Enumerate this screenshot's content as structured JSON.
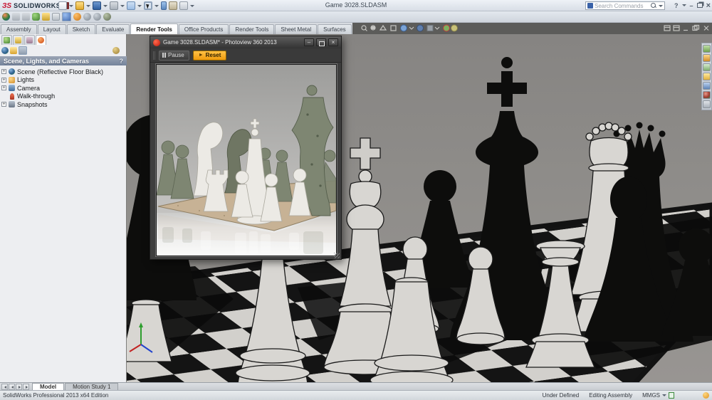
{
  "titlebar": {
    "brand_mark": "ЗS",
    "brand": "SOLIDWORKS",
    "title": "Game 3028.SLDASM",
    "search_placeholder": "Search Commands",
    "help_glyph": "?",
    "minimize_glyph": "–",
    "close_glyph": "×"
  },
  "standard_toolbar_icons": [
    "new",
    "open",
    "save",
    "print",
    "undo",
    "select",
    "hide-show",
    "appearance",
    "view-settings"
  ],
  "render_toolbar_icons": [
    "edit-appearance",
    "copy-appearance",
    "paste-appearance",
    "edit-scene",
    "edit-decal",
    "target-area",
    "preview-window",
    "integrated-preview",
    "final-render",
    "render-region",
    "options"
  ],
  "commandbar": {
    "tabs": [
      {
        "label": "Assembly",
        "active": false
      },
      {
        "label": "Layout",
        "active": false
      },
      {
        "label": "Sketch",
        "active": false
      },
      {
        "label": "Evaluate",
        "active": false
      },
      {
        "label": "Render Tools",
        "active": true
      },
      {
        "label": "Office Products",
        "active": false
      },
      {
        "label": "Render Tools",
        "active": false
      },
      {
        "label": "Sheet Metal",
        "active": false
      },
      {
        "label": "Surfaces",
        "active": false
      }
    ]
  },
  "headsup_icons": [
    "zoom-fit",
    "zoom-area",
    "previous-view",
    "section-view",
    "view-orientation",
    "display-style",
    "hide-show-items",
    "edit-appearance",
    "apply-scene",
    "view-settings"
  ],
  "feature_panel": {
    "header": "Scene, Lights, and Cameras",
    "help_glyph": "?",
    "expand_glyph": "+",
    "manager_tabs": [
      "featuremanager",
      "propertymanager",
      "configurationmanager",
      "displaymanager"
    ],
    "display_pane_icons": [
      "view-scene",
      "view-lights",
      "view-cameras",
      "appearance-filter"
    ],
    "tree": [
      {
        "label": "Scene (Reflective Floor Black)",
        "icon": "scene-icon",
        "expandable": true
      },
      {
        "label": "Lights",
        "icon": "lights-icon",
        "expandable": true
      },
      {
        "label": "Camera",
        "icon": "camera-icon",
        "expandable": true
      },
      {
        "label": "Walk-through",
        "icon": "walkthrough-icon",
        "expandable": false
      },
      {
        "label": "Snapshots",
        "icon": "snapshots-icon",
        "expandable": true
      }
    ]
  },
  "preview_window": {
    "title": "Game 3028.SLDASM* - Photoview 360 2013",
    "pause_label": "Pause",
    "reset_label": "Reset",
    "reset_glyph": "►",
    "minimize_glyph": "–",
    "close_glyph": "×"
  },
  "taskpane_icons": [
    "solidworks-resources",
    "design-library",
    "file-explorer",
    "view-palette",
    "appearances-scenes",
    "custom-properties",
    "document-recovery"
  ],
  "bottombar": {
    "tabs": [
      {
        "label": "Model",
        "active": true
      },
      {
        "label": "Motion Study 1",
        "active": false
      }
    ]
  },
  "statusbar": {
    "left": "SolidWorks Professional 2013 x64 Edition",
    "constraint_status": "Under Defined",
    "edit_mode": "Editing Assembly",
    "units": "MMGS"
  },
  "colors": {
    "accent_orange": "#efa11c",
    "viewport_gray": "#8e8c89",
    "panel_bg": "#edeef1",
    "dark_strip": "#5b5b59",
    "black_piece": "#0d0d0c",
    "white_piece": "#d8d6d2",
    "board_tan": "#c7b295",
    "green_piece": "#7e8672"
  }
}
